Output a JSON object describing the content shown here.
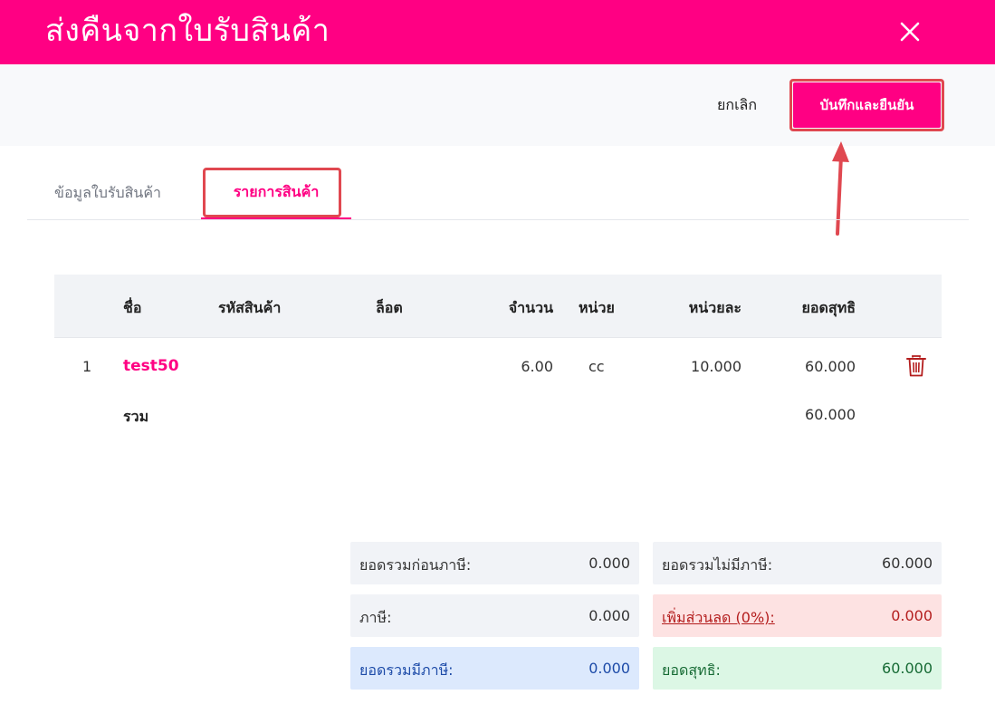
{
  "header": {
    "title": "ส่งคืนจากใบรับสินค้า"
  },
  "toolbar": {
    "cancel_label": "ยกเลิก",
    "save_label": "บันทึกและยืนยัน"
  },
  "tabs": [
    {
      "label": "ข้อมูลใบรับสินค้า",
      "active": false
    },
    {
      "label": "รายการสินค้า",
      "active": true
    }
  ],
  "table": {
    "headers": {
      "name": "ชื่อ",
      "code": "รหัสสินค้า",
      "lot": "ล็อต",
      "qty": "จำนวน",
      "unit": "หน่วย",
      "unit_price": "หน่วยละ",
      "net": "ยอดสุทธิ"
    },
    "rows": [
      {
        "index": "1",
        "name": "test50",
        "code": "",
        "lot": "",
        "qty": "6.00",
        "unit": "cc",
        "unit_price": "10.000",
        "net": "60.000"
      }
    ],
    "total": {
      "label": "รวม",
      "value": "60.000"
    }
  },
  "summary": {
    "pre_tax": {
      "label": "ยอดรวมก่อนภาษี:",
      "value": "0.000"
    },
    "tax": {
      "label": "ภาษี:",
      "value": "0.000"
    },
    "with_tax": {
      "label": "ยอดรวมมีภาษี:",
      "value": "0.000"
    },
    "no_tax": {
      "label": "ยอดรวมไม่มีภาษี:",
      "value": "60.000"
    },
    "discount": {
      "label": "เพิ่มส่วนลด (0%):",
      "value": "0.000"
    },
    "net": {
      "label": "ยอดสุทธิ:",
      "value": "60.000"
    }
  },
  "colors": {
    "brand": "#ff0083",
    "highlight": "#e04850",
    "danger": "#b41e1e"
  },
  "icons": {
    "close": "close-icon",
    "delete": "trash-icon",
    "arrow": "arrow-up-icon"
  }
}
